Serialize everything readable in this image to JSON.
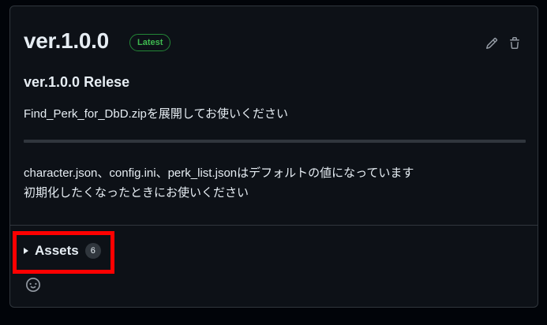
{
  "release": {
    "title": "ver.1.0.0",
    "badge": "Latest",
    "heading": "ver.1.0.0 Relese",
    "line1": "Find_Perk_for_DbD.zipを展開してお使いください",
    "line2": "character.json、config.ini、perk_list.jsonはデフォルトの値になっています",
    "line3": "初期化したくなったときにお使いください"
  },
  "actions": {
    "edit_icon": "pencil-icon",
    "delete_icon": "trash-icon"
  },
  "assets": {
    "label": "Assets",
    "count": "6"
  },
  "reactions": {
    "icon": "smiley-icon"
  },
  "colors": {
    "background": "#010409",
    "card": "#0d1117",
    "border": "#30363d",
    "latest_green": "#3fb950",
    "highlight": "#ff0000"
  }
}
